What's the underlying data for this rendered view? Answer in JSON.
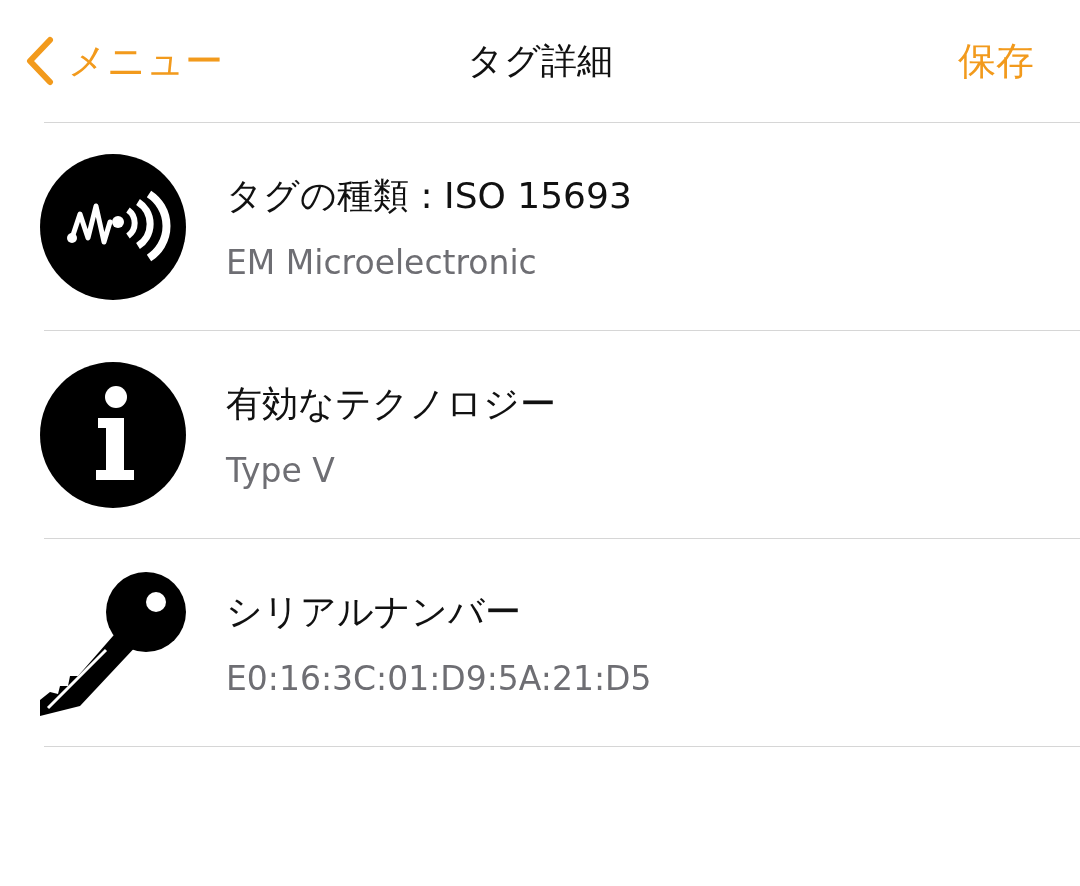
{
  "nav": {
    "back": "メニュー",
    "title": "タグ詳細",
    "action": "保存"
  },
  "rows": [
    {
      "kind": "tag",
      "title": "タグの種類 : ISO 15693",
      "subtitle": "EM Microelectronic"
    },
    {
      "kind": "info",
      "title": "有効なテクノロジー",
      "subtitle": "Type V"
    },
    {
      "kind": "key",
      "title": "シリアルナンバー",
      "subtitle": "E0:16:3C:01:D9:5A:21:D5"
    }
  ]
}
